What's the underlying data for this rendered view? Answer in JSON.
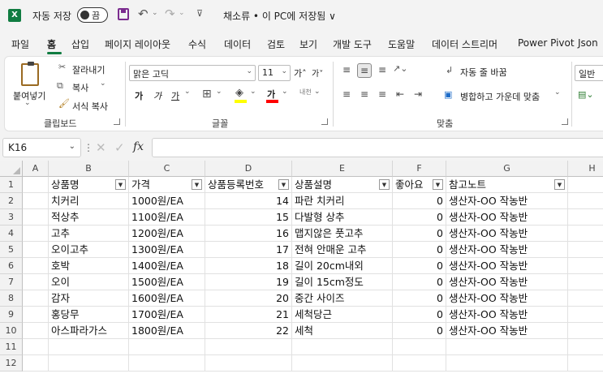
{
  "titlebar": {
    "app_logo": "X",
    "autosave_label": "자동 저장",
    "autosave_state": "끔",
    "document_title": "채소류 • 이 PC에 저장됨 ∨",
    "icons": [
      "excel-logo-icon",
      "save-icon",
      "undo-icon",
      "redo-icon",
      "customize-qat-icon"
    ]
  },
  "menu": {
    "tabs": [
      "파일",
      "홈",
      "삽입",
      "페이지 레이아웃",
      "수식",
      "데이터",
      "검토",
      "보기",
      "개발 도구",
      "도움말",
      "데이터 스트리머",
      "Power Pivot",
      "Json"
    ],
    "active_tab": "홈"
  },
  "ribbon": {
    "clipboard": {
      "paste": "붙여넣기",
      "cut": "잘라내기",
      "copy": "복사",
      "format_painter": "서식 복사",
      "group_label": "클립보드"
    },
    "font": {
      "font_name": "맑은 고딕",
      "font_size": "11",
      "grow": "가˄",
      "shrink": "가˅",
      "bold": "가",
      "italic": "가",
      "underline": "가",
      "border": "⊞",
      "fill_color": "#ffff00",
      "font_color": "#ff0000",
      "phonetic": "내천",
      "group_label": "글꼴"
    },
    "alignment": {
      "wrap_text": "자동 줄 바꿈",
      "merge_center": "병합하고 가운데 맞춤",
      "group_label": "맞춤"
    },
    "number": {
      "format": "일반"
    }
  },
  "formula_bar": {
    "name_box": "K16",
    "fx": "fx",
    "value": ""
  },
  "sheet": {
    "columns": [
      "A",
      "B",
      "C",
      "D",
      "E",
      "F",
      "G",
      "H"
    ],
    "rows": [
      "1",
      "2",
      "3",
      "4",
      "5",
      "6",
      "7",
      "8",
      "9",
      "10",
      "11",
      "12"
    ],
    "headers": [
      "상품명",
      "가격",
      "상품등록번호",
      "상품설명",
      "좋아요",
      "참고노트"
    ],
    "data": [
      [
        "치커리",
        "1000원/EA",
        "14",
        "파란 치커리",
        "0",
        "생산자-OO 작농반"
      ],
      [
        "적상추",
        "1100원/EA",
        "15",
        "다발형 상추",
        "0",
        "생산자-OO 작농반"
      ],
      [
        "고추",
        "1200원/EA",
        "16",
        "맵지않은 풋고추",
        "0",
        "생산자-OO 작농반"
      ],
      [
        "오이고추",
        "1300원/EA",
        "17",
        "전혀 안매운 고추",
        "0",
        "생산자-OO 작농반"
      ],
      [
        "호박",
        "1400원/EA",
        "18",
        "길이 20cm내외",
        "0",
        "생산자-OO 작농반"
      ],
      [
        "오이",
        "1500원/EA",
        "19",
        "길이 15cm정도",
        "0",
        "생산자-OO 작농반"
      ],
      [
        "감자",
        "1600원/EA",
        "20",
        "중간 사이즈",
        "0",
        "생산자-OO 작농반"
      ],
      [
        "홍당무",
        "1700원/EA",
        "21",
        "세척당근",
        "0",
        "생산자-OO 작농반"
      ],
      [
        "아스파라가스",
        "1800원/EA",
        "22",
        "세척",
        "0",
        "생산자-OO 작농반"
      ]
    ]
  }
}
